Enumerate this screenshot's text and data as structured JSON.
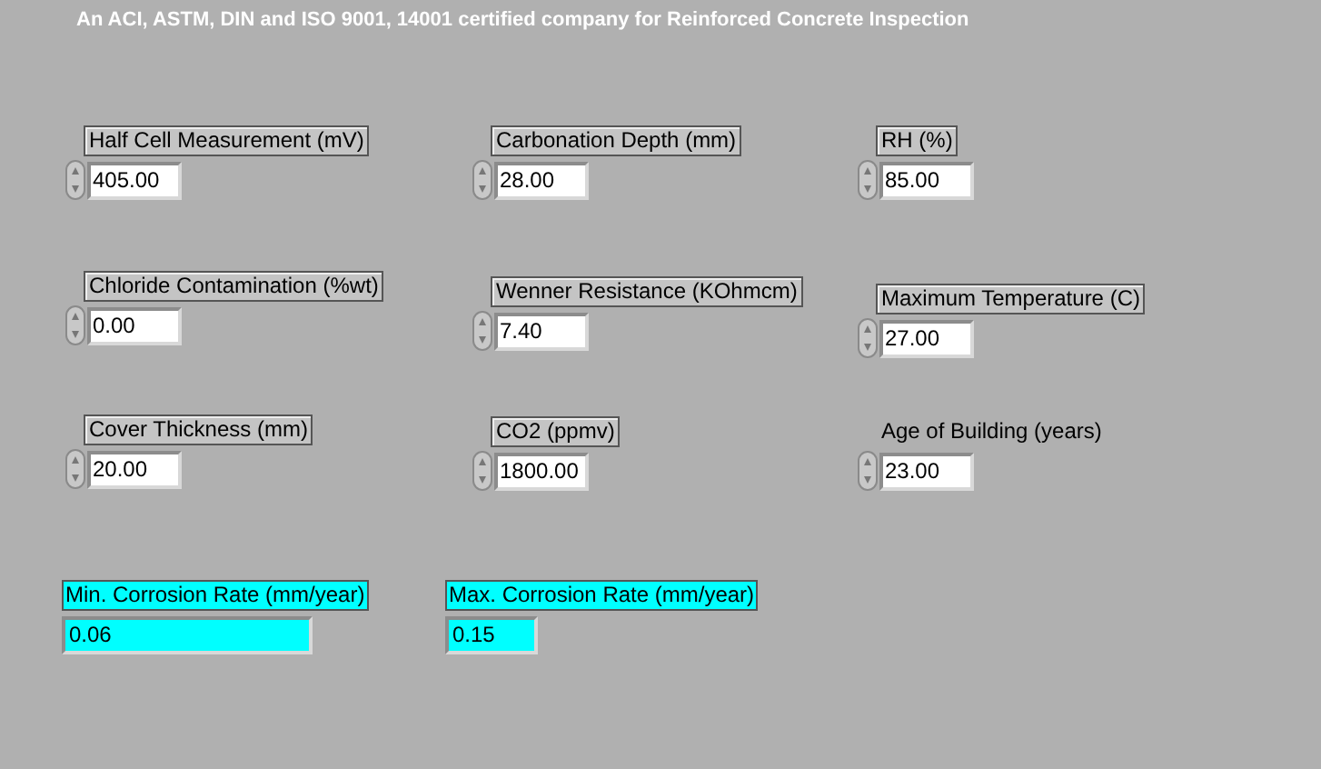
{
  "header": "An ACI, ASTM, DIN and ISO 9001, 14001 certified company for Reinforced Concrete Inspection",
  "inputs": [
    {
      "label": "Half Cell Measurement (mV)",
      "value": "405.00",
      "framed": true
    },
    {
      "label": "Carbonation Depth (mm)",
      "value": "28.00",
      "framed": true
    },
    {
      "label": "RH (%)",
      "value": "85.00",
      "framed": true
    },
    {
      "label": "Chloride Contamination (%wt)",
      "value": "0.00",
      "framed": true
    },
    {
      "label": "Wenner Resistance (KOhmcm)",
      "value": "7.40",
      "framed": true
    },
    {
      "label": "Maximum Temperature (C)",
      "value": "27.00",
      "framed": true
    },
    {
      "label": "Cover Thickness (mm)",
      "value": "20.00",
      "framed": true
    },
    {
      "label": "CO2 (ppmv)",
      "value": "1800.00",
      "framed": true
    },
    {
      "label": "Age of Building (years)",
      "value": "23.00",
      "framed": false
    }
  ],
  "outputs": [
    {
      "label": "Min. Corrosion Rate (mm/year)",
      "value": "0.06"
    },
    {
      "label": "Max. Corrosion Rate (mm/year)",
      "value": "0.15"
    }
  ]
}
